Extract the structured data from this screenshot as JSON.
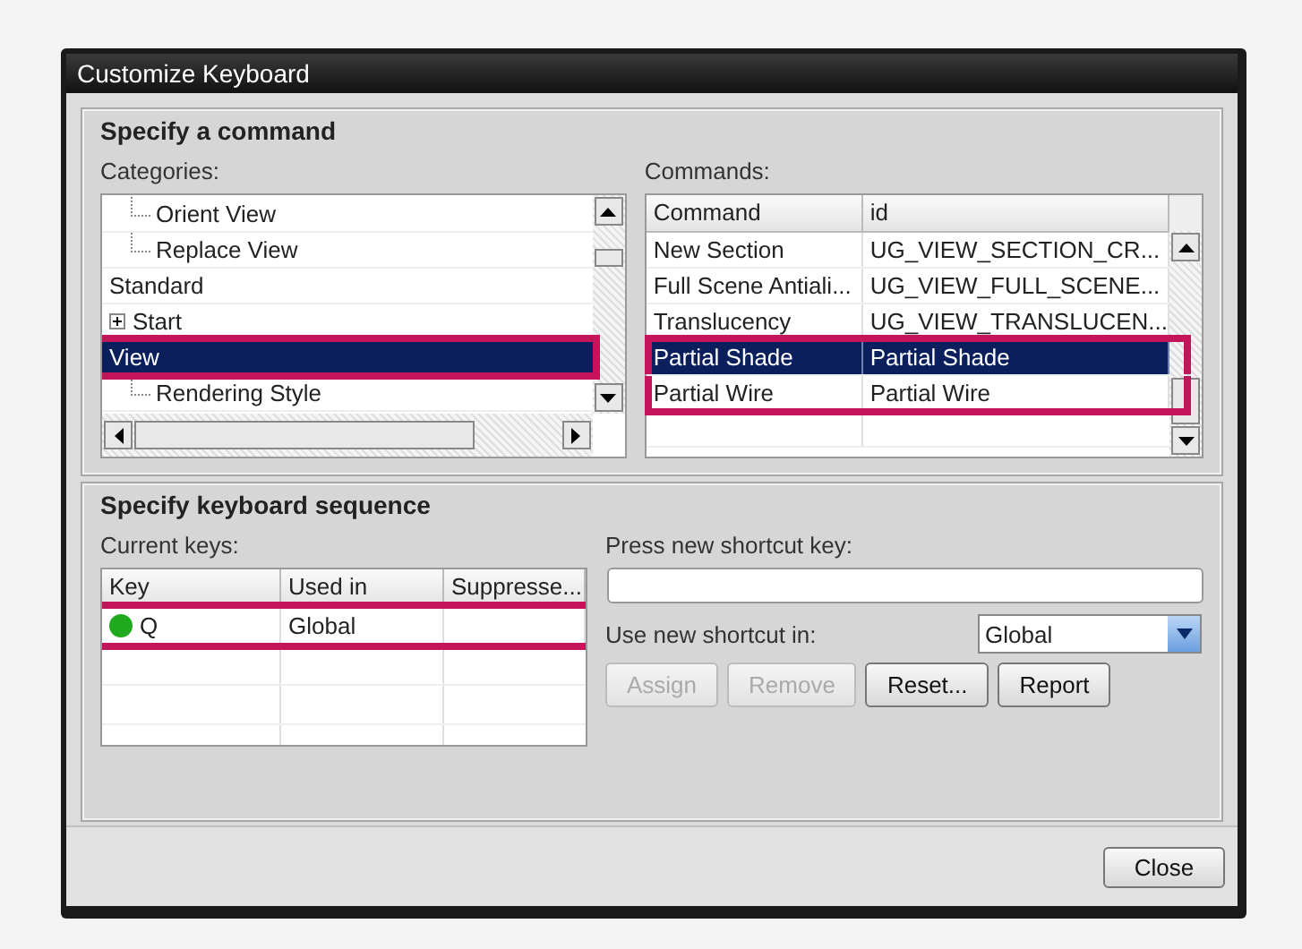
{
  "window": {
    "title": "Customize Keyboard"
  },
  "command_group": {
    "title": "Specify a command",
    "categories_label": "Categories:",
    "commands_label": "Commands:",
    "categories": [
      {
        "children": [
          {
            "label": "Orient View",
            "selected": false,
            "annotated": false
          },
          {
            "label": "Replace View",
            "selected": false,
            "annotated": false
          }
        ]
      },
      {
        "label": "Standard",
        "selected": false,
        "annotated": false
      },
      {
        "label": "Start",
        "selected": false,
        "expanded": false,
        "annotated": false
      },
      {
        "label": "View",
        "selected": true,
        "annotated": true,
        "children": [
          {
            "label": "Rendering Style",
            "selected": false,
            "annotated": false
          }
        ]
      }
    ],
    "commands": {
      "columns": [
        "Command",
        "id"
      ],
      "rows": [
        {
          "cells": [
            "New Section",
            "UG_VIEW_SECTION_CR..."
          ],
          "selected": false,
          "annotated": false
        },
        {
          "cells": [
            "Full Scene Antiali...",
            "UG_VIEW_FULL_SCENE..."
          ],
          "selected": false,
          "annotated": false
        },
        {
          "cells": [
            "Translucency",
            "UG_VIEW_TRANSLUCEN..."
          ],
          "selected": false,
          "annotated": false
        },
        {
          "cells": [
            "Partial Shade",
            "Partial Shade"
          ],
          "selected": true,
          "annotated": true
        },
        {
          "cells": [
            "Partial Wire",
            "Partial Wire"
          ],
          "selected": false,
          "annotated": true
        }
      ]
    }
  },
  "sequence_group": {
    "title": "Specify keyboard sequence",
    "current_keys_label": "Current keys:",
    "keys": {
      "columns": [
        "Key",
        "Used in",
        "Suppresse..."
      ],
      "rows": [
        {
          "cells": [
            "Q",
            "Global"
          ],
          "color": "#1faa1f",
          "annotated": true
        }
      ]
    },
    "shortcut_label": "Press new shortcut key:",
    "use_in_label": "Use new shortcut in:",
    "use_in_value": "Global",
    "buttons": [
      {
        "label": "Assign",
        "disabled": true
      },
      {
        "label": "Remove",
        "disabled": true
      },
      {
        "label": "Reset...",
        "disabled": false
      },
      {
        "label": "Report",
        "disabled": false
      }
    ]
  },
  "footer": {
    "close_button": "Close"
  }
}
